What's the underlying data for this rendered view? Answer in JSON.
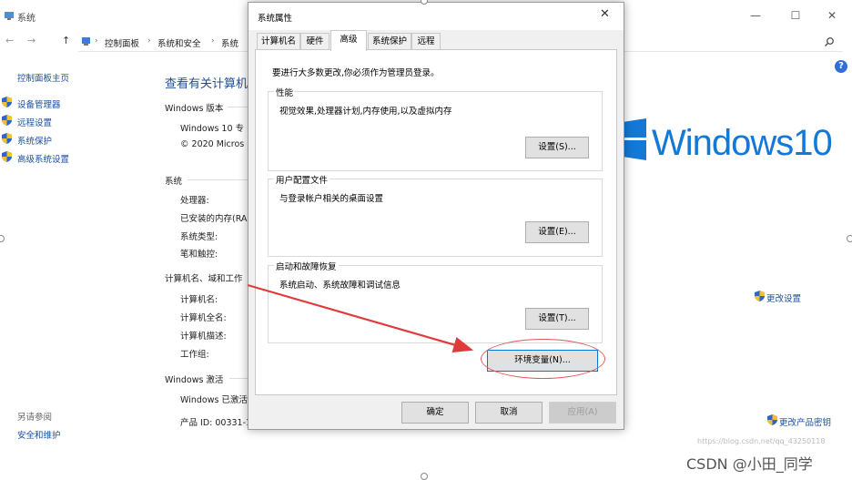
{
  "bg_window": {
    "title": "系统",
    "controls": {
      "minimize": "—",
      "maximize": "☐",
      "close": "✕"
    },
    "nav": {
      "back": "←",
      "forward": "→",
      "up": "↑"
    },
    "breadcrumbs": [
      "控制面板",
      "系统和安全",
      "系统"
    ],
    "crumb_sep": "›"
  },
  "sidebar": {
    "home": "控制面板主页",
    "items": [
      {
        "label": "设备管理器"
      },
      {
        "label": "远程设置"
      },
      {
        "label": "系统保护"
      },
      {
        "label": "高级系统设置"
      }
    ],
    "see_also": "另请参阅",
    "see_also_link": "安全和维护"
  },
  "main": {
    "title": "查看有关计算机",
    "edition_head": "Windows 版本",
    "edition_name": "Windows 10 专",
    "copyright": "© 2020 Micros",
    "system_head": "系统",
    "system_rows": [
      "处理器:",
      "已安装的内存(RA",
      "系统类型:",
      "笔和触控:"
    ],
    "computer_head": "计算机名、域和工作",
    "computer_rows": [
      "计算机名:",
      "计算机全名:",
      "计算机描述:",
      "工作组:"
    ],
    "change_settings": "更改设置",
    "activation_head": "Windows 激活",
    "activation_status": "Windows 已激活",
    "product_id": "产品 ID: 00331-1",
    "change_key": "更改产品密钥",
    "logo_text": "Windows10",
    "help": "?"
  },
  "dialog": {
    "title": "系统属性",
    "close": "✕",
    "tabs": [
      "计算机名",
      "硬件",
      "高级",
      "系统保护",
      "远程"
    ],
    "active_tab": "高级",
    "admin_note": "要进行大多数更改,你必须作为管理员登录。",
    "groups": [
      {
        "title": "性能",
        "desc": "视觉效果,处理器计划,内存使用,以及虚拟内存",
        "button": "设置(S)..."
      },
      {
        "title": "用户配置文件",
        "desc": "与登录帐户相关的桌面设置",
        "button": "设置(E)..."
      },
      {
        "title": "启动和故障恢复",
        "desc": "系统启动、系统故障和调试信息",
        "button": "设置(T)..."
      }
    ],
    "env_button": "环境变量(N)...",
    "ok": "确定",
    "cancel": "取消",
    "apply": "应用(A)"
  },
  "watermark": {
    "csdn": "CSDN @小田_同学",
    "url": "https://blog.csdn.net/qq_43250118"
  },
  "colors": {
    "accent": "#1479d6",
    "link": "#1a4f9c",
    "annotation": "#e03b3b"
  }
}
